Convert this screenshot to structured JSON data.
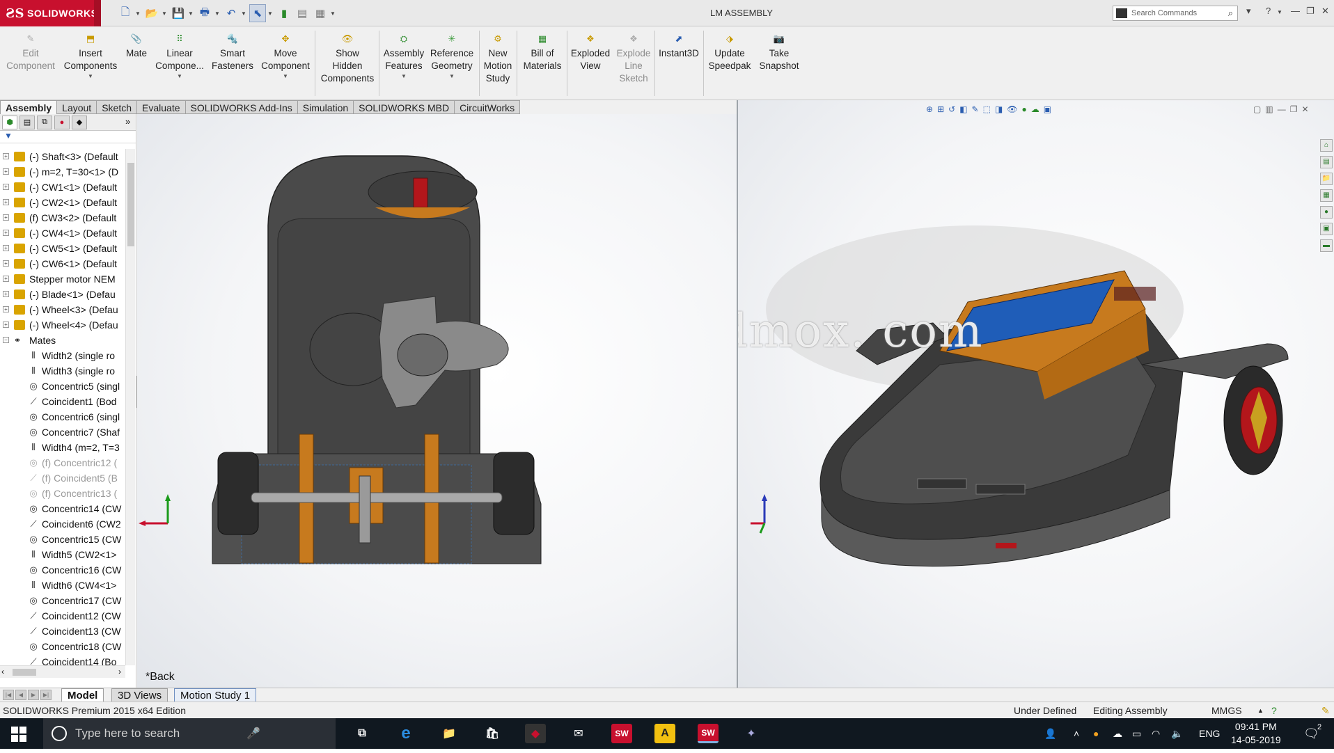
{
  "app": {
    "brand": "SOLIDWORKS",
    "doc_title": "LM ASSEMBLY",
    "search_placeholder": "Search Commands",
    "accent": "#c8102e"
  },
  "commands": [
    {
      "label": "Edit Component",
      "lines": [
        "Edit",
        "Component"
      ],
      "enabled": false
    },
    {
      "label": "Insert Components",
      "lines": [
        "Insert",
        "Components"
      ],
      "enabled": true
    },
    {
      "label": "Mate",
      "lines": [
        "Mate"
      ],
      "enabled": true
    },
    {
      "label": "Linear Component Pattern",
      "lines": [
        "Linear",
        "Compone..."
      ],
      "enabled": true
    },
    {
      "label": "Smart Fasteners",
      "lines": [
        "Smart",
        "Fasteners"
      ],
      "enabled": true
    },
    {
      "label": "Move Component",
      "lines": [
        "Move",
        "Component"
      ],
      "enabled": true
    },
    {
      "label": "Show Hidden Components",
      "lines": [
        "Show",
        "Hidden",
        "Components"
      ],
      "enabled": true
    },
    {
      "label": "Assembly Features",
      "lines": [
        "Assembly",
        "Features"
      ],
      "enabled": true
    },
    {
      "label": "Reference Geometry",
      "lines": [
        "Reference",
        "Geometry"
      ],
      "enabled": true
    },
    {
      "label": "New Motion Study",
      "lines": [
        "New",
        "Motion",
        "Study"
      ],
      "enabled": true
    },
    {
      "label": "Bill of Materials",
      "lines": [
        "Bill of",
        "Materials"
      ],
      "enabled": true
    },
    {
      "label": "Exploded View",
      "lines": [
        "Exploded",
        "View"
      ],
      "enabled": true
    },
    {
      "label": "Explode Line Sketch",
      "lines": [
        "Explode",
        "Line",
        "Sketch"
      ],
      "enabled": false
    },
    {
      "label": "Instant3D",
      "lines": [
        "Instant3D"
      ],
      "enabled": true
    },
    {
      "label": "Update Speedpak",
      "lines": [
        "Update",
        "Speedpak"
      ],
      "enabled": true
    },
    {
      "label": "Take Snapshot",
      "lines": [
        "Take",
        "Snapshot"
      ],
      "enabled": true
    }
  ],
  "tabs": [
    "Assembly",
    "Layout",
    "Sketch",
    "Evaluate",
    "SOLIDWORKS Add-Ins",
    "Simulation",
    "SOLIDWORKS MBD",
    "CircuitWorks"
  ],
  "tree": {
    "parts": [
      "(-) Shaft<3> (Default",
      "(-) m=2, T=30<1> (D",
      "(-) CW1<1> (Default",
      "(-) CW2<1> (Default",
      "(f) CW3<2> (Default",
      "(-) CW4<1> (Default",
      "(-) CW5<1> (Default",
      "(-) CW6<1> (Default",
      "Stepper motor NEM",
      "(-) Blade<1> (Defau",
      "(-) Wheel<3> (Defau",
      "(-) Wheel<4> (Defau"
    ],
    "mates_label": "Mates",
    "mates": [
      {
        "text": "Width2 (single ro",
        "kind": "width",
        "suppressed": false
      },
      {
        "text": "Width3 (single ro",
        "kind": "width",
        "suppressed": false
      },
      {
        "text": "Concentric5 (singl",
        "kind": "concentric",
        "suppressed": false
      },
      {
        "text": "Coincident1 (Bod",
        "kind": "coincident",
        "suppressed": false
      },
      {
        "text": "Concentric6 (singl",
        "kind": "concentric",
        "suppressed": false
      },
      {
        "text": "Concentric7 (Shaf",
        "kind": "concentric",
        "suppressed": false
      },
      {
        "text": "Width4 (m=2, T=3",
        "kind": "width",
        "suppressed": false
      },
      {
        "text": "(f) Concentric12 (",
        "kind": "concentric",
        "suppressed": true
      },
      {
        "text": "(f) Coincident5 (B",
        "kind": "coincident",
        "suppressed": true
      },
      {
        "text": "(f) Concentric13 (",
        "kind": "concentric",
        "suppressed": true
      },
      {
        "text": "Concentric14 (CW",
        "kind": "concentric",
        "suppressed": false
      },
      {
        "text": "Coincident6 (CW2",
        "kind": "coincident",
        "suppressed": false
      },
      {
        "text": "Concentric15 (CW",
        "kind": "concentric",
        "suppressed": false
      },
      {
        "text": "Width5 (CW2<1>",
        "kind": "width",
        "suppressed": false
      },
      {
        "text": "Concentric16 (CW",
        "kind": "concentric",
        "suppressed": false
      },
      {
        "text": "Width6 (CW4<1>",
        "kind": "width",
        "suppressed": false
      },
      {
        "text": "Concentric17 (CW",
        "kind": "concentric",
        "suppressed": false
      },
      {
        "text": "Coincident12 (CW",
        "kind": "coincident",
        "suppressed": false
      },
      {
        "text": "Coincident13 (CW",
        "kind": "coincident",
        "suppressed": false
      },
      {
        "text": "Concentric18 (CW",
        "kind": "concentric",
        "suppressed": false
      },
      {
        "text": "Coincident14 (Bo",
        "kind": "coincident",
        "suppressed": false
      }
    ]
  },
  "viewports": {
    "left_label": "*Back",
    "watermark": "莫西网www. 3dmox. com"
  },
  "model_tabs": [
    "Model",
    "3D Views",
    "Motion Study 1"
  ],
  "status": {
    "edition": "SOLIDWORKS Premium 2015 x64 Edition",
    "definition": "Under Defined",
    "mode": "Editing Assembly",
    "units": "MMGS"
  },
  "taskbar": {
    "search_placeholder": "Type here to search",
    "language": "ENG",
    "time": "09:41 PM",
    "date": "14-05-2019",
    "notification_count": "2"
  }
}
